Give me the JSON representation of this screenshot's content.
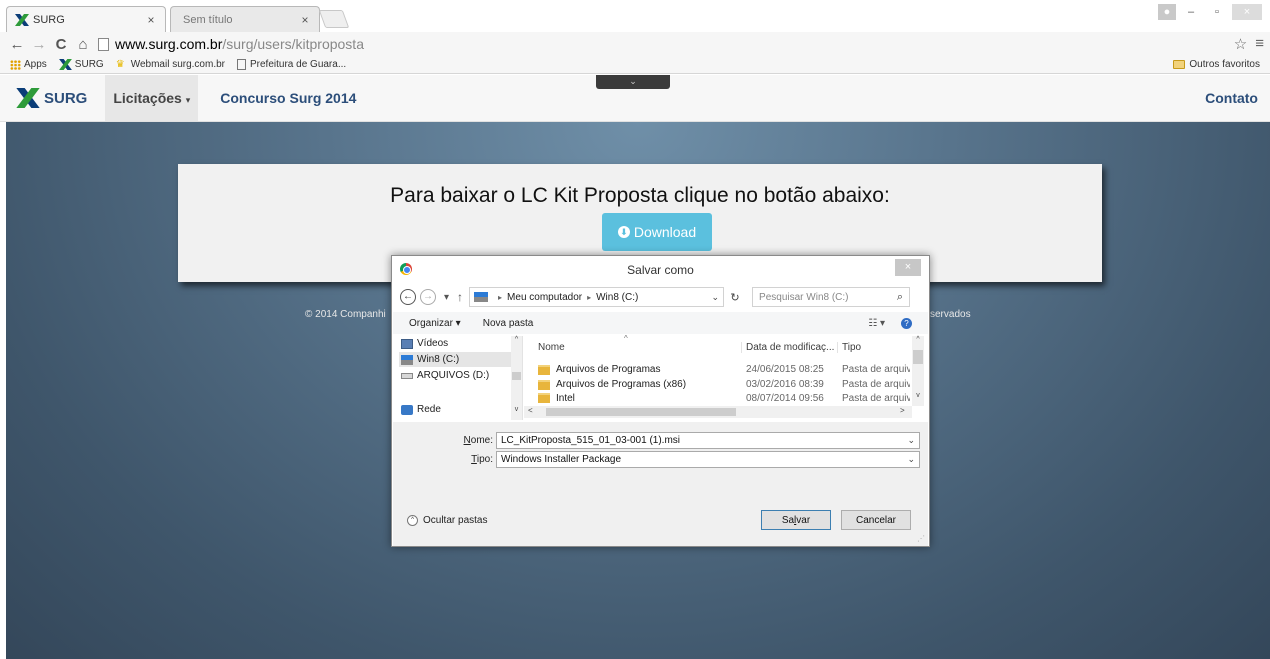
{
  "browser": {
    "tabs": [
      {
        "title": "SURG",
        "close": "×"
      },
      {
        "title": "Sem título",
        "close": "×"
      }
    ],
    "window_controls": {
      "minimize": "–",
      "restore": "▫",
      "close": "×"
    },
    "nav": {
      "back": "←",
      "forward": "→",
      "reload": "C",
      "home": "⌂"
    },
    "url": {
      "host": "www.surg.com.br",
      "path": "/surg/users/kitproposta"
    },
    "toolbar_right": {
      "star": "☆",
      "menu": "≡"
    },
    "bookmarks": [
      {
        "label": "Apps"
      },
      {
        "label": "SURG"
      },
      {
        "label": "Webmail surg.com.br"
      },
      {
        "label": "Prefeitura de Guara..."
      }
    ],
    "other_bookmarks": "Outros favoritos"
  },
  "site": {
    "brand": "SURG",
    "nav": {
      "licitacoes": "Licitações",
      "caret": "▾",
      "concurso": "Concurso Surg 2014",
      "contato": "Contato"
    },
    "pull_tab": "⌄",
    "hero_title": "Para baixar o LC Kit Proposta clique no botão abaixo:",
    "download_label": "Download",
    "download_icon": "⬇",
    "footer_left": "© 2014 Companhi",
    "footer_right": "servados"
  },
  "dialog": {
    "title": "Salvar como",
    "close": "×",
    "address": {
      "back": "←",
      "forward": "→",
      "recent": "▾",
      "up": "↑",
      "crumbs": [
        "Meu computador",
        "Win8 (C:)"
      ],
      "crumb_sep": "▸",
      "dropdown": "⌄",
      "refresh": "↻"
    },
    "search_placeholder": "Pesquisar Win8 (C:)",
    "search_icon": "⌕",
    "commands": {
      "organize": "Organizar ▾",
      "new_folder": "Nova pasta",
      "view": "☷ ▾",
      "help": "?"
    },
    "nav_pane": [
      {
        "label": "Vídeos",
        "icon": "video-icon"
      },
      {
        "label": "Win8 (C:)",
        "icon": "drive-icon",
        "selected": true
      },
      {
        "label": "ARQUIVOS (D:)",
        "icon": "drive-icon"
      },
      {
        "label": "Rede",
        "icon": "network-icon"
      }
    ],
    "scroll_arrows": {
      "up": "^",
      "down": "v",
      "left": "<",
      "right": ">"
    },
    "columns": {
      "name": "Nome",
      "date": "Data de modificaç...",
      "type": "Tipo",
      "sort_arrow": "^"
    },
    "files": [
      {
        "name": "Arquivos de Programas",
        "date": "24/06/2015 08:25",
        "type": "Pasta de arquivos"
      },
      {
        "name": "Arquivos de Programas (x86)",
        "date": "03/02/2016 08:39",
        "type": "Pasta de arquivos"
      },
      {
        "name": "Intel",
        "date": "08/07/2014 09:56",
        "type": "Pasta de arquivos"
      }
    ],
    "filename_label_u": "N",
    "filename_label_rest": "ome:",
    "filename_value": "LC_KitProposta_515_01_03-001 (1).msi",
    "filetype_label_u": "T",
    "filetype_label_rest": "ipo:",
    "filetype_value": "Windows Installer Package",
    "hide_folders": "Ocultar pastas",
    "hide_icon": "^",
    "save_label_pre": "Sa",
    "save_label_u": "l",
    "save_label_post": "var",
    "cancel_label": "Cancelar"
  }
}
